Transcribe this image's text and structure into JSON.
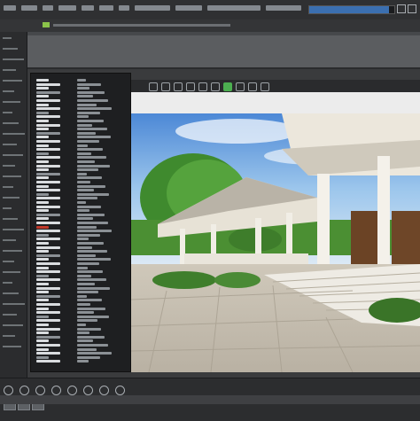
{
  "menubar": {
    "progress": 0.96,
    "accent": "#3b6fb0"
  },
  "panel": {
    "highlight_color": "#c0392b"
  },
  "toolbar": {
    "active_tool_color": "#4caf50",
    "tools": [
      "select-icon",
      "move-icon",
      "rotate-icon",
      "scale-icon",
      "camera-icon",
      "light-icon",
      "render-icon",
      "grid-icon",
      "snap-icon",
      "settings-icon"
    ]
  },
  "viewport": {
    "scene": "3d-render-house-porch",
    "sky_color": "#7fb4e6",
    "tree_color": "#3f8a2e"
  },
  "statusbar": {
    "icons": [
      "play-icon",
      "pause-icon",
      "stop-icon",
      "record-icon",
      "keyframe-icon",
      "loop-icon",
      "zoom-icon",
      "settings-icon"
    ]
  }
}
